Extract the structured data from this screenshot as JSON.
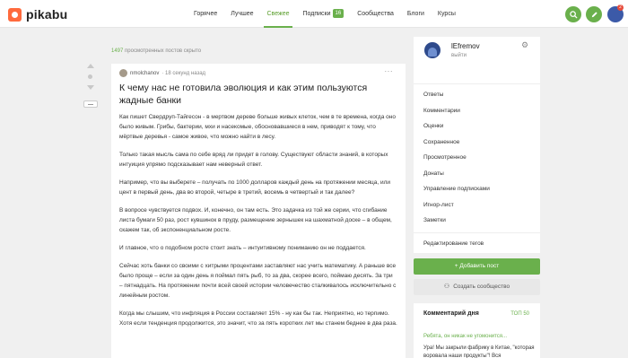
{
  "header": {
    "logo": "pikabu",
    "nav": [
      {
        "label": "Горячее",
        "active": false
      },
      {
        "label": "Лучшее",
        "active": false
      },
      {
        "label": "Свежее",
        "active": true
      },
      {
        "label": "Подписки",
        "active": false,
        "badge": "16"
      },
      {
        "label": "Сообщества",
        "active": false
      },
      {
        "label": "Блоги",
        "active": false
      },
      {
        "label": "Курсы",
        "active": false
      }
    ],
    "icons": [
      "search-icon",
      "pencil-icon",
      "mail-icon"
    ],
    "notification_count": "2",
    "accent_color": "#6ab04c"
  },
  "feed": {
    "hidden_count": "1497",
    "hidden_label": "просмотренных постов скрыто"
  },
  "post": {
    "author": "nmolchanov",
    "time": "· 18 секунд назад",
    "title": "К чему нас не готовила эволюция и как этим пользуются жадные банки",
    "paragraphs": [
      "Как пишет Свердруп-Тайгесон - в мертвом дереве больше живых клеток, чем в те времена, когда оно было живым. Грибы, бактерии, мхи и насекомые, обосновавшиеся в нем, приводят к тому, что мёртвые деревья - самое живое, что можно найти в лесу.",
      "Только такая мысль сама по себе вряд ли придет в голову. Существуют области знаний, в которых интуиция упрямо подсказывает нам неверный ответ.",
      "Например, что вы выберете – получать по 1000 долларов каждый день на протяжении месяца, или цент в первый день, два во второй, четыре в третий, восемь в четвертый и так далее?",
      "В вопросе чувствуется подвох. И, конечно, он там есть. Это задачка из той же серии, что сгибание листа бумаги 50 раз, рост кувшинок в пруду, размещение зернышек на шахматной доске – в общем, скажем так, об экспоненциальном росте.",
      "И главное, что о подобном росте стоит знать – интуитивному пониманию он не поддается.",
      "Сейчас хоть банки со своими с хитрыми процентами заставляют нас учить математику. А раньше все было проще – если за один день я поймал пять рыб, то за два, скорее всего, поймаю десять. За три – пятнадцать. На протяжении почти всей своей истории человечество сталкивалось исключительно с линейным ростом.",
      "Когда мы слышим, что инфляция в России составляет 15% - ну как бы так. Неприятно, но терпимо. Хотя если тенденция продолжится, это значит, что за пять коротких лет мы станем беднее в два раза."
    ]
  },
  "sidebar": {
    "username": "lEfremov",
    "logout": "выйти",
    "menu": [
      "Ответы",
      "Комментарии",
      "Оценки",
      "Сохраненное",
      "Просмотренное",
      "Донаты",
      "Управление подписками",
      "Игнор-лист",
      "Заметки"
    ],
    "edit_tags": "Редактирование тегов",
    "add_post": "+ Добавить пост",
    "create_community": "Создать сообщество",
    "comment_of_day": {
      "title": "Комментарий дня",
      "top": "ТОП 50",
      "link": "Ребята, он никак не угомонится...",
      "text": "Ура! Мы закрыли фабрику в Китае, \"которая воровала наши продукты\"! Вся"
    }
  }
}
